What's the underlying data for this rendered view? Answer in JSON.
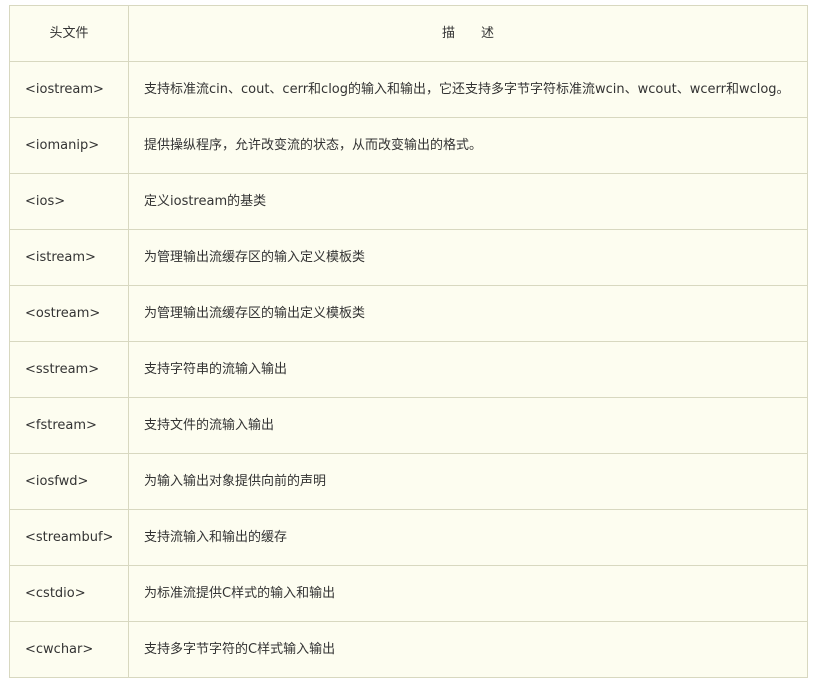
{
  "table": {
    "headers": [
      "头文件",
      "描　　述"
    ],
    "rows": [
      {
        "header": "<iostream>",
        "description": "支持标准流cin、cout、cerr和clog的输入和输出，它还支持多字节字符标准流wcin、wcout、wcerr和wclog。"
      },
      {
        "header": "<iomanip>",
        "description": "提供操纵程序，允许改变流的状态，从而改变输出的格式。"
      },
      {
        "header": "<ios>",
        "description": "定义iostream的基类"
      },
      {
        "header": "<istream>",
        "description": "为管理输出流缓存区的输入定义模板类"
      },
      {
        "header": "<ostream>",
        "description": "为管理输出流缓存区的输出定义模板类"
      },
      {
        "header": "<sstream>",
        "description": "支持字符串的流输入输出"
      },
      {
        "header": "<fstream>",
        "description": "支持文件的流输入输出"
      },
      {
        "header": "<iosfwd>",
        "description": "为输入输出对象提供向前的声明"
      },
      {
        "header": "<streambuf>",
        "description": "支持流输入和输出的缓存"
      },
      {
        "header": "<cstdio>",
        "description": "为标准流提供C样式的输入和输出"
      },
      {
        "header": "<cwchar>",
        "description": "支持多字节字符的C样式输入输出"
      }
    ]
  },
  "colors": {
    "background": "#fdfdf0",
    "border": "#d8d8c0",
    "text": "#333333"
  }
}
